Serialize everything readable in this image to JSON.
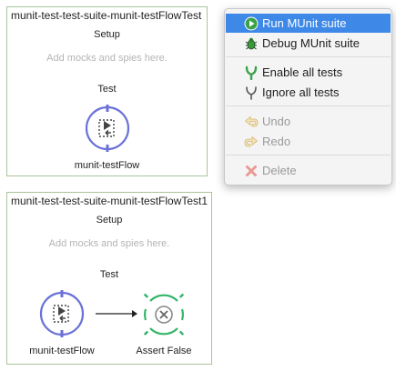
{
  "cards": [
    {
      "title": "munit-test-test-suite-munit-testFlowTest",
      "setup_label": "Setup",
      "setup_hint": "Add mocks and spies here.",
      "test_label": "Test",
      "flow_label": "munit-testFlow"
    },
    {
      "title": "munit-test-test-suite-munit-testFlowTest1",
      "setup_label": "Setup",
      "setup_hint": "Add mocks and spies here.",
      "test_label": "Test",
      "flow_label": "munit-testFlow",
      "assert_label": "Assert False"
    }
  ],
  "context_menu": {
    "items": [
      {
        "label": "Run MUnit suite",
        "icon": "run-icon",
        "state": "highlighted"
      },
      {
        "label": "Debug MUnit suite",
        "icon": "debug-bug-icon",
        "state": "enabled"
      },
      {
        "label": "Enable all tests",
        "icon": "enable-tests-icon",
        "state": "enabled"
      },
      {
        "label": "Ignore all tests",
        "icon": "ignore-tests-icon",
        "state": "enabled"
      },
      {
        "label": "Undo",
        "icon": "undo-icon",
        "state": "disabled"
      },
      {
        "label": "Redo",
        "icon": "redo-icon",
        "state": "disabled"
      },
      {
        "label": "Delete",
        "icon": "delete-icon",
        "state": "disabled"
      }
    ]
  },
  "colors": {
    "flow_ring": "#6a72d8",
    "assert_ring": "#36b56a",
    "menu_highlight": "#3e88e8",
    "card_border": "#a9c49a"
  }
}
